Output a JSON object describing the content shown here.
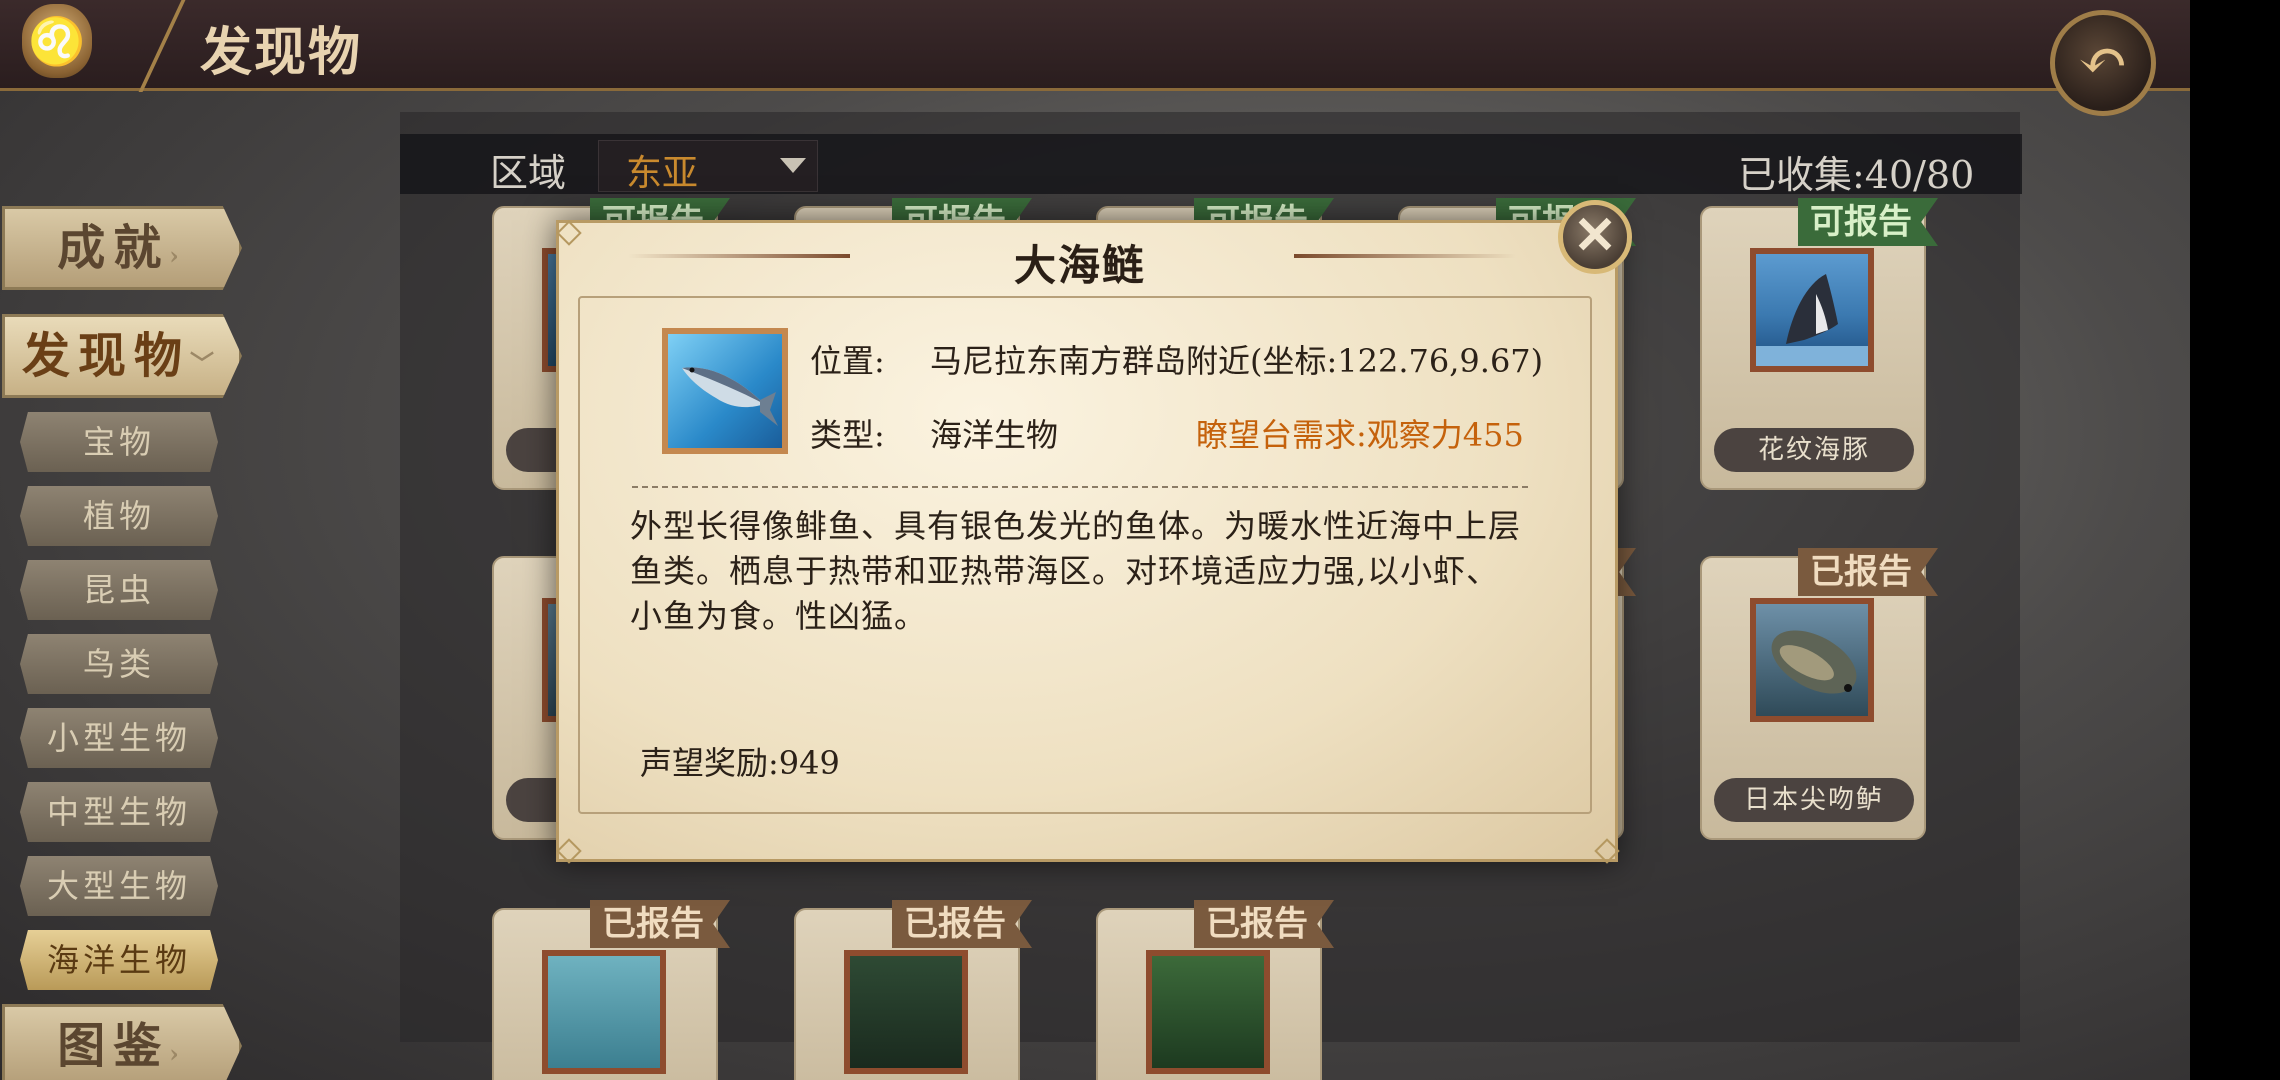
{
  "header": {
    "title": "发现物",
    "logo_icon": "lion-emblem-icon",
    "back_icon": "back-arrow-icon"
  },
  "menu": {
    "big": [
      {
        "label": "成就",
        "arrow": "›"
      },
      {
        "label": "发现物",
        "arrow": "﹀"
      },
      {
        "label": "图鉴",
        "arrow": "›"
      }
    ],
    "sub": [
      "宝物",
      "植物",
      "昆虫",
      "鸟类",
      "小型生物",
      "中型生物",
      "大型生物",
      "海洋生物"
    ]
  },
  "filter": {
    "region_label": "区域",
    "region_value": "东亚",
    "collected": "已收集:40/80"
  },
  "cards": {
    "tag_can": "可报告",
    "tag_done": "已报告",
    "dolphin_name": "花纹海豚",
    "bass_name": "日本尖吻鲈"
  },
  "dialog": {
    "title": "大海鲢",
    "location_label": "位置:",
    "location_value": "马尼拉东南方群岛附近(坐标:122.76,9.67)",
    "type_label": "类型:",
    "type_value": "海洋生物",
    "requirement": "瞭望台需求:观察力455",
    "description": "外型长得像鲱鱼、具有银色发光的鱼体。为暖水性近海中上层鱼类。栖息于热带和亚热带海区。对环境适应力强,以小虾、小鱼为食。性凶猛。",
    "reward": "声望奖励:949",
    "close_icon": "close-icon",
    "fish_icon": "tarpon-fish-icon"
  },
  "colors": {
    "accent_orange": "#c5620c",
    "tag_green": "#3a6b3a",
    "tag_brown": "#7a5a3e",
    "header_dark": "#2a1d1e"
  }
}
